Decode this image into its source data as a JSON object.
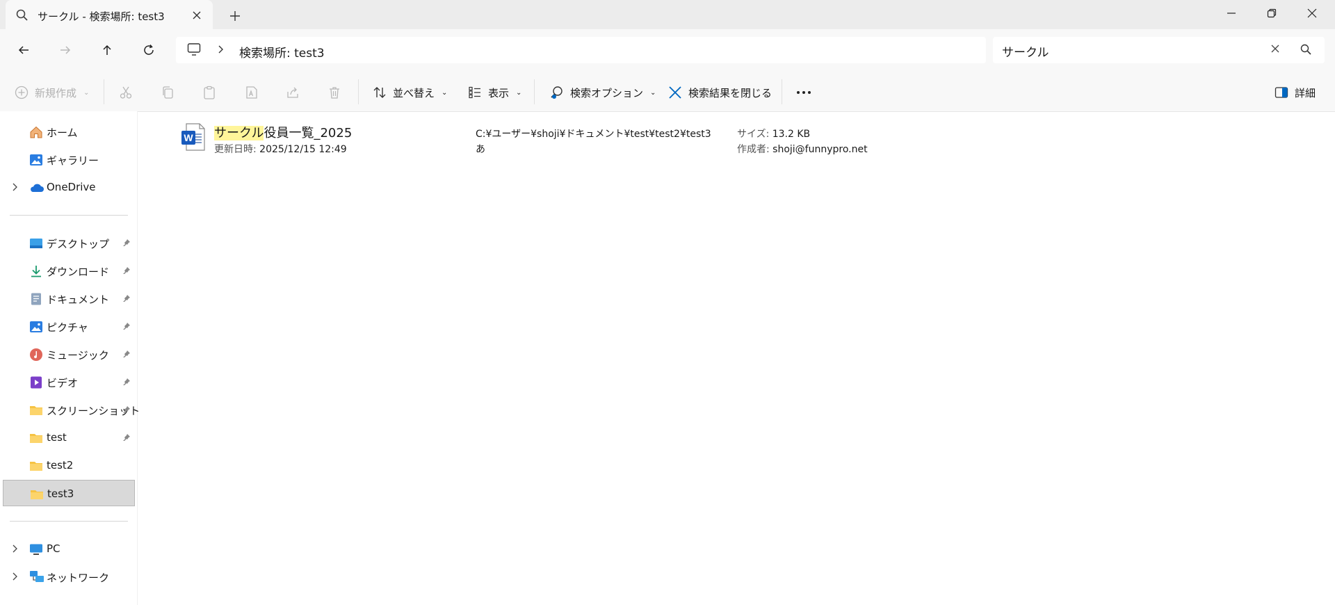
{
  "window": {
    "tab_title": "サークル - 検索場所: test3",
    "new_tab_symbol": "+"
  },
  "address": {
    "location": "検索場所: test3"
  },
  "search": {
    "query": "サークル"
  },
  "toolbar": {
    "new_label": "新規作成",
    "sort_label": "並べ替え",
    "view_label": "表示",
    "search_options_label": "検索オプション",
    "close_search_label": "検索結果を閉じる",
    "details_label": "詳細"
  },
  "sidebar": {
    "home": "ホーム",
    "gallery": "ギャラリー",
    "onedrive": "OneDrive",
    "desktop": "デスクトップ",
    "downloads": "ダウンロード",
    "documents": "ドキュメント",
    "pictures": "ピクチャ",
    "music": "ミュージック",
    "videos": "ビデオ",
    "screenshots": "スクリーンショット",
    "test": "test",
    "test2": "test2",
    "test3": "test3",
    "pc": "PC",
    "network": "ネットワーク"
  },
  "results": [
    {
      "name_match": "サークル",
      "name_rest": "役員一覧_2025",
      "modified_label": "更新日時:",
      "modified_value": "2025/12/15 12:49",
      "path_line1": "C:¥ユーザー¥shoji¥ドキュメント¥test¥test2¥test3",
      "path_line2": "あ",
      "size_label": "サイズ:",
      "size_value": "13.2 KB",
      "author_label": "作成者:",
      "author_value": "shoji@funnypro.net"
    }
  ],
  "colors": {
    "accent_blue": "#0067c0",
    "highlight": "#fff59a",
    "word_blue": "#185abd"
  }
}
